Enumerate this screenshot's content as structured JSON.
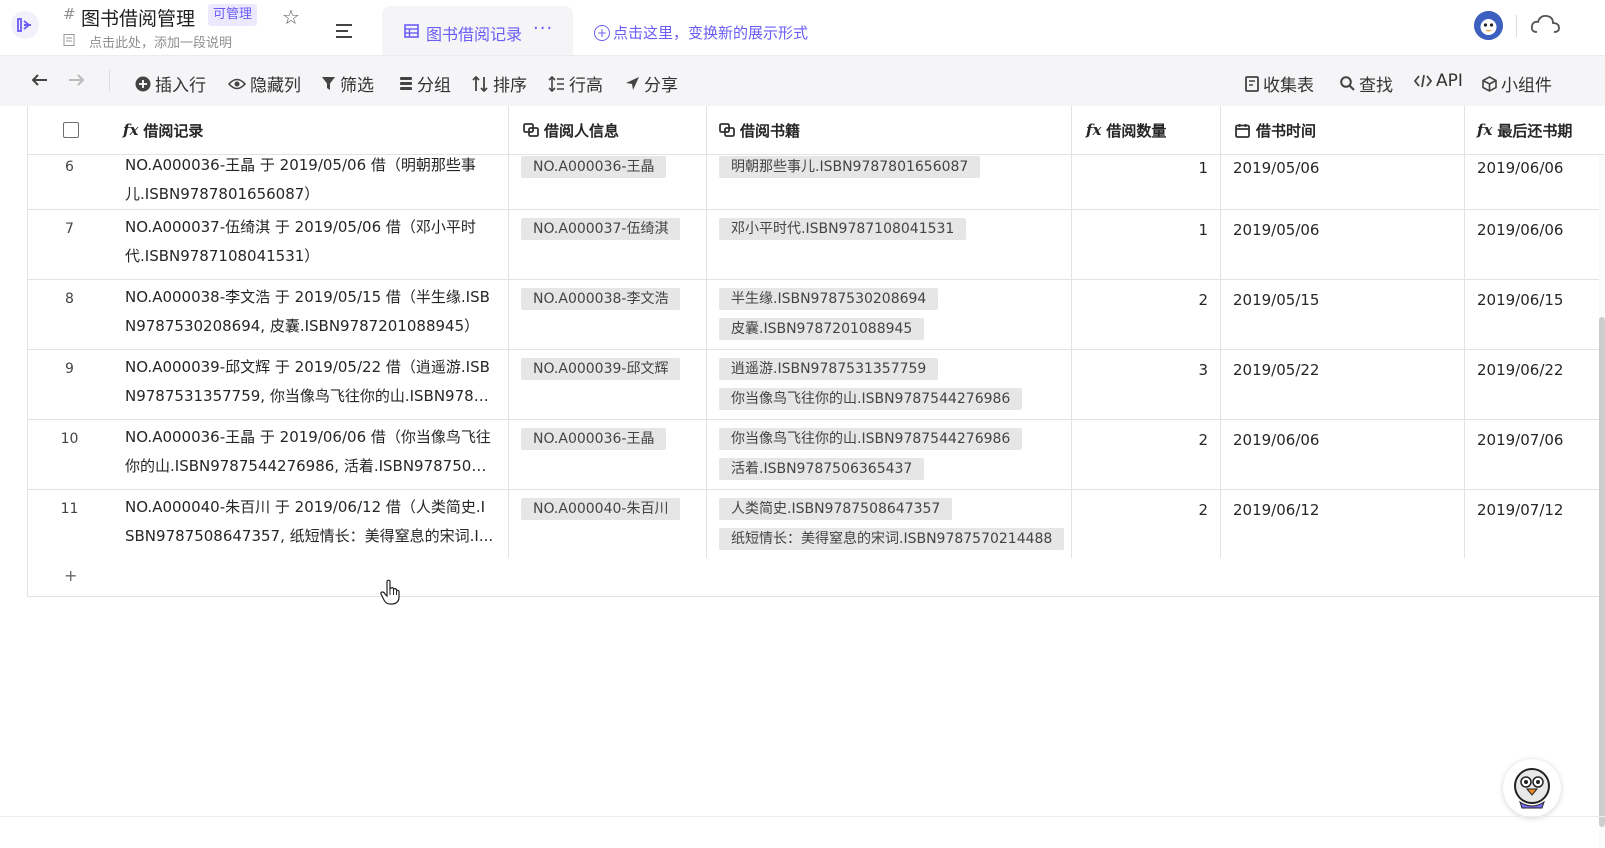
{
  "header": {
    "hash_symbol": "#",
    "title": "图书借阅管理",
    "manage_badge": "可管理",
    "description_placeholder": "点击此处，添加一段说明",
    "view_tab": {
      "label": "图书借阅记录",
      "more": "···"
    },
    "new_view_label": "点击这里，变换新的展示形式"
  },
  "toolbar": {
    "insert_row": "插入行",
    "hide_column": "隐藏列",
    "filter": "筛选",
    "group": "分组",
    "sort": "排序",
    "row_height": "行高",
    "share": "分享",
    "form": "收集表",
    "find": "查找",
    "api": "API",
    "widget": "小组件"
  },
  "columns": [
    {
      "label": "借阅记录",
      "icon": "formula-icon"
    },
    {
      "label": "借阅人信息",
      "icon": "link-icon"
    },
    {
      "label": "借阅书籍",
      "icon": "link-icon"
    },
    {
      "label": "借阅数量",
      "icon": "formula-icon"
    },
    {
      "label": "借书时间",
      "icon": "calendar-icon"
    },
    {
      "label": "最后还书期",
      "icon": "formula-icon"
    }
  ],
  "icon_glyphs": {
    "formula": "fx"
  },
  "rows": [
    {
      "num": "6",
      "record": [
        "NO.A000036-王晶 于 2019/05/06 借（明朝那些事",
        "儿.ISBN9787801656087）"
      ],
      "borrower": "NO.A000036-王晶",
      "books": [
        "明朝那些事儿.ISBN9787801656087"
      ],
      "qty": "1",
      "borrow_date": "2019/05/06",
      "due_date": "2019/06/06"
    },
    {
      "num": "7",
      "record": [
        "NO.A000037-伍绮淇 于 2019/05/06 借（邓小平时",
        "代.ISBN9787108041531）"
      ],
      "borrower": "NO.A000037-伍绮淇",
      "books": [
        "邓小平时代.ISBN9787108041531"
      ],
      "qty": "1",
      "borrow_date": "2019/05/06",
      "due_date": "2019/06/06"
    },
    {
      "num": "8",
      "record": [
        "NO.A000038-李文浩 于 2019/05/15 借（半生缘.ISB",
        "N9787530208694, 皮囊.ISBN9787201088945）"
      ],
      "borrower": "NO.A000038-李文浩",
      "books": [
        "半生缘.ISBN9787530208694",
        "皮囊.ISBN9787201088945"
      ],
      "qty": "2",
      "borrow_date": "2019/05/15",
      "due_date": "2019/06/15"
    },
    {
      "num": "9",
      "record": [
        "NO.A000039-邱文辉 于 2019/05/22 借（逍遥游.ISB",
        "N9787531357759, 你当像鸟飞往你的山.ISBN9787..."
      ],
      "borrower": "NO.A000039-邱文辉",
      "books": [
        "逍遥游.ISBN9787531357759",
        "你当像鸟飞往你的山.ISBN9787544276986"
      ],
      "qty": "3",
      "borrow_date": "2019/05/22",
      "due_date": "2019/06/22"
    },
    {
      "num": "10",
      "record": [
        "NO.A000036-王晶 于 2019/06/06 借（你当像鸟飞往",
        "你的山.ISBN9787544276986, 活着.ISBN97875063..."
      ],
      "borrower": "NO.A000036-王晶",
      "books": [
        "你当像鸟飞往你的山.ISBN9787544276986",
        "活着.ISBN9787506365437"
      ],
      "qty": "2",
      "borrow_date": "2019/06/06",
      "due_date": "2019/07/06"
    },
    {
      "num": "11",
      "record": [
        "NO.A000040-朱百川 于 2019/06/12 借（人类简史.I",
        "SBN9787508647357, 纸短情长：美得窒息的宋词.I..."
      ],
      "borrower": "NO.A000040-朱百川",
      "books": [
        "人类简史.ISBN9787508647357",
        "纸短情长：美得窒息的宋词.ISBN9787570214488"
      ],
      "qty": "2",
      "borrow_date": "2019/06/12",
      "due_date": "2019/07/12"
    }
  ],
  "add_row_symbol": "+"
}
